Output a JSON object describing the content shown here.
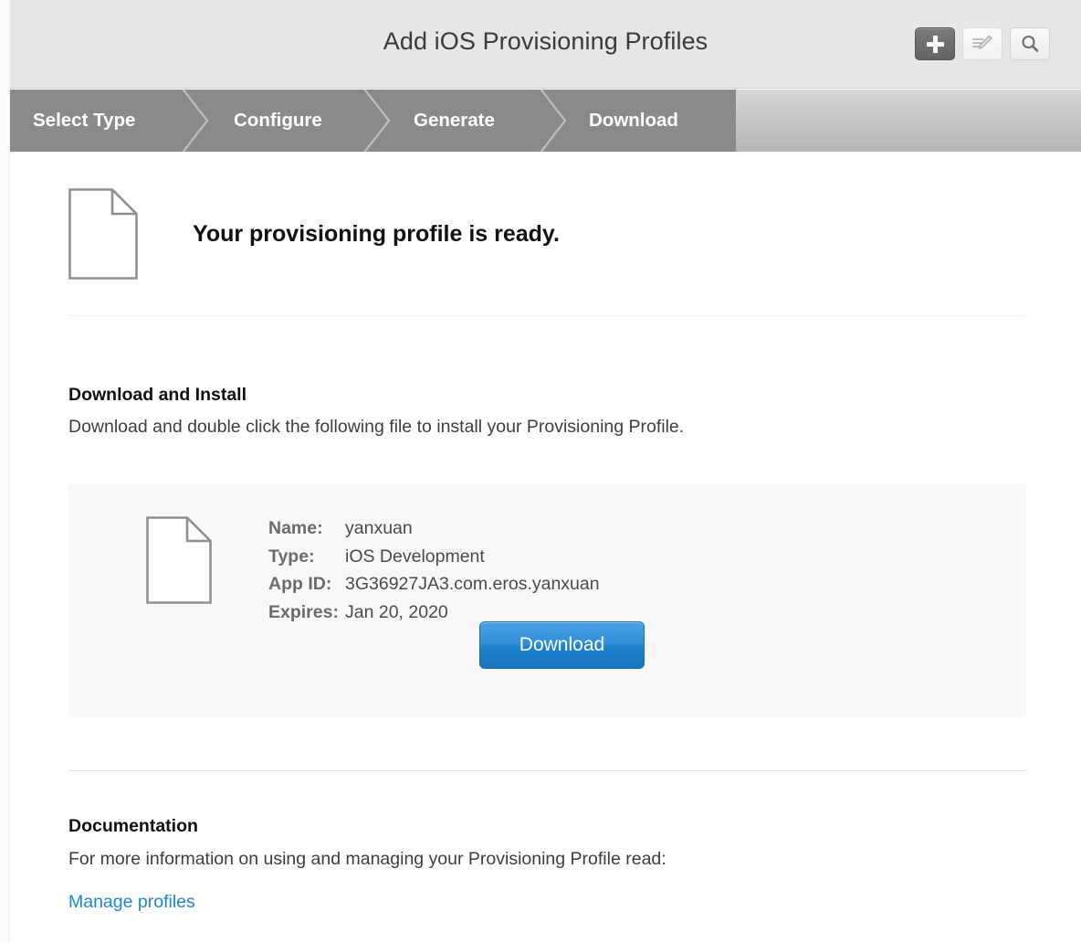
{
  "window": {
    "title": "Add iOS Provisioning Profiles"
  },
  "toolbar": {
    "add_label": "+",
    "add_icon": "plus-icon",
    "edit_icon": "edit-pencil-icon",
    "search_icon": "search-magnifier-icon"
  },
  "steps": [
    {
      "label": "Select Type",
      "active": true
    },
    {
      "label": "Configure",
      "active": true
    },
    {
      "label": "Generate",
      "active": true
    },
    {
      "label": "Download",
      "active": true
    }
  ],
  "hero": {
    "icon": "document-icon",
    "title": "Your provisioning profile is ready."
  },
  "download_section": {
    "heading": "Download and Install",
    "description": "Download and double click the following file to install your Provisioning Profile."
  },
  "profile": {
    "icon": "document-icon",
    "fields": [
      {
        "label": "Name:",
        "value": "yanxuan"
      },
      {
        "label": "Type:",
        "value": "iOS Development"
      },
      {
        "label": "App ID:",
        "value": "3G36927JA3.com.eros.yanxuan"
      },
      {
        "label": "Expires:",
        "value": "Jan 20, 2020"
      }
    ],
    "download_button": "Download"
  },
  "documentation": {
    "heading": "Documentation",
    "description": "For more information on using and managing your Provisioning Profile read:",
    "link": "Manage profiles"
  },
  "colors": {
    "header_bg": "#e6e6e6",
    "step_active": "#8a8a8a",
    "card_bg": "#f8f8f8",
    "accent_blue": "#1f86c8",
    "button_blue": "#2e8ed8"
  }
}
